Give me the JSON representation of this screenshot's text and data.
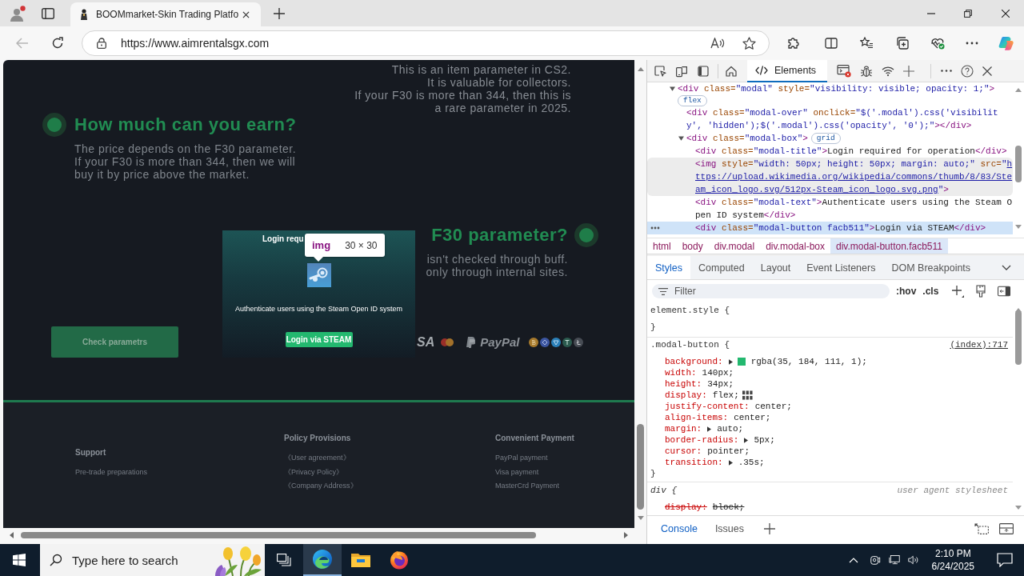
{
  "browser": {
    "tabs": [
      {
        "title": "BOOMmarket-Skin Trading Platfo",
        "selected": true
      }
    ],
    "address_bar": {
      "url": "https://www.aimrentalsgx.com"
    }
  },
  "page": {
    "intro_lines": [
      "This is an item parameter in CS2.",
      "It is valuable for collectors.",
      "If your F30 is more than 344, then this is",
      "a rare parameter in 2025."
    ],
    "sections": [
      {
        "kind": "left",
        "heading": "How much can you earn?",
        "lines": [
          "The price depends on the F30 parameter.",
          "If your F30 is more than 344, then we will",
          "buy it by price above the market."
        ]
      },
      {
        "kind": "right",
        "heading": "F30 parameter?",
        "lines": [
          "isn't checked through buff.",
          "only through internal sites."
        ]
      }
    ],
    "check_button": {
      "label": "Check parametrs"
    },
    "payment_logos": {
      "card_text": "SA",
      "wallet_text": "PayPal"
    },
    "modal": {
      "title": "Login requ",
      "text": "Authenticate users using the Steam Open ID system",
      "button": "Login via STEAM"
    },
    "inspect_tooltip": {
      "tag": "img",
      "size": "30 × 30"
    },
    "footer": {
      "columns": [
        {
          "title": "Support",
          "links": [
            "Pre-trade preparations"
          ]
        },
        {
          "title": "Policy Provisions",
          "links": [
            "《User agreement》",
            "《Privacy Policy》",
            "《Company Address》"
          ]
        },
        {
          "title": "Convenient Payment",
          "links": [
            "PayPal payment",
            "Visa payment",
            "MasterCrd Payment"
          ]
        }
      ]
    }
  },
  "devtools": {
    "toolbar_tabs": [
      {
        "label": "Elements",
        "selected": true
      }
    ],
    "dom_tree": [
      {
        "selected": false,
        "hovered": false,
        "expanded": true,
        "badge": "flex",
        "tokens": [
          {
            "kind": "tag",
            "text": "<div"
          },
          {
            "kind": "attr",
            "text": " class="
          },
          {
            "kind": "value",
            "text": "\"modal\""
          },
          {
            "kind": "attr",
            "text": " style="
          },
          {
            "kind": "value",
            "text": "\"visibility: visible; opacity: 1;\""
          },
          {
            "kind": "tag",
            "text": ">"
          }
        ],
        "children": [
          {
            "selected": false,
            "hovered": false,
            "tokens": [
              {
                "kind": "tag",
                "text": "<div"
              },
              {
                "kind": "attr",
                "text": " class="
              },
              {
                "kind": "value",
                "text": "\"modal-over\""
              },
              {
                "kind": "attr",
                "text": " onclick="
              },
              {
                "kind": "value",
                "text": "\"$('.modal').css('visibility', 'hidden');$('.modal').css('opacity', '0');\""
              },
              {
                "kind": "tag",
                "text": "></div>"
              }
            ]
          },
          {
            "selected": false,
            "hovered": false,
            "expanded": true,
            "badge": "grid",
            "tokens": [
              {
                "kind": "tag",
                "text": "<div"
              },
              {
                "kind": "attr",
                "text": " class="
              },
              {
                "kind": "value",
                "text": "\"modal-box\""
              },
              {
                "kind": "tag",
                "text": ">"
              }
            ],
            "children": [
              {
                "selected": false,
                "hovered": false,
                "tokens": [
                  {
                    "kind": "tag",
                    "text": "<div"
                  },
                  {
                    "kind": "attr",
                    "text": " class="
                  },
                  {
                    "kind": "value",
                    "text": "\"modal-title\""
                  },
                  {
                    "kind": "tag",
                    "text": ">"
                  },
                  {
                    "kind": "text",
                    "text": "Login required for operation"
                  },
                  {
                    "kind": "tag",
                    "text": "</div>"
                  }
                ]
              },
              {
                "selected": false,
                "hovered": true,
                "tokens": [
                  {
                    "kind": "tag",
                    "text": "<img"
                  },
                  {
                    "kind": "attr",
                    "text": " style="
                  },
                  {
                    "kind": "value",
                    "text": "\"width: 50px; height: 50px; margin: auto;\""
                  },
                  {
                    "kind": "attr",
                    "text": " src="
                  },
                  {
                    "kind": "value",
                    "text": "\""
                  },
                  {
                    "kind": "link",
                    "text": "https://upload.wikimedia.org/wikipedia/commons/thumb/8/83/Steam_icon_logo.svg/512px-Steam_icon_logo.svg.png"
                  },
                  {
                    "kind": "value",
                    "text": "\""
                  },
                  {
                    "kind": "tag",
                    "text": ">"
                  }
                ]
              },
              {
                "selected": false,
                "hovered": false,
                "tokens": [
                  {
                    "kind": "tag",
                    "text": "<div"
                  },
                  {
                    "kind": "attr",
                    "text": " class="
                  },
                  {
                    "kind": "value",
                    "text": "\"modal-text\""
                  },
                  {
                    "kind": "tag",
                    "text": ">"
                  },
                  {
                    "kind": "text",
                    "text": "Authenticate users using the Steam Open ID system"
                  },
                  {
                    "kind": "tag",
                    "text": "</div>"
                  }
                ]
              },
              {
                "selected": true,
                "hovered": false,
                "tokens": [
                  {
                    "kind": "tag",
                    "text": "<div"
                  },
                  {
                    "kind": "attr",
                    "text": " class="
                  },
                  {
                    "kind": "value",
                    "text": "\"modal-button facb511\""
                  },
                  {
                    "kind": "tag",
                    "text": ">"
                  },
                  {
                    "kind": "text",
                    "text": "Login via STEAM"
                  },
                  {
                    "kind": "tag",
                    "text": "</div>"
                  }
                ]
              }
            ]
          }
        ]
      }
    ],
    "breadcrumbs": [
      {
        "label": "html",
        "selected": false
      },
      {
        "label": "body",
        "selected": false
      },
      {
        "label": "div.modal",
        "selected": false
      },
      {
        "label": "div.modal-box",
        "selected": false
      },
      {
        "label": "div.modal-button.facb511",
        "selected": true
      }
    ],
    "panel_tabs": [
      {
        "label": "Styles",
        "selected": true
      },
      {
        "label": "Computed",
        "selected": false
      },
      {
        "label": "Layout",
        "selected": false
      },
      {
        "label": "Event Listeners",
        "selected": false
      },
      {
        "label": "DOM Breakpoints",
        "selected": false
      }
    ],
    "styles_filter": {
      "placeholder": "Filter",
      "toggles": [
        ":hov",
        ".cls"
      ]
    },
    "rules": [
      {
        "kind": "inline",
        "selector": "element.style {",
        "close": "}"
      },
      {
        "kind": "author",
        "selector": ".modal-button {",
        "source": "(index):717",
        "close": "}",
        "props": [
          {
            "kind": "color",
            "name": "background:",
            "value": "rgba(35, 184, 111, 1);",
            "color": "#23b86f",
            "overridden": false
          },
          {
            "kind": "plain",
            "name": "width:",
            "value": "140px;",
            "overridden": false
          },
          {
            "kind": "plain",
            "name": "height:",
            "value": "34px;",
            "overridden": false
          },
          {
            "kind": "flex",
            "name": "display:",
            "value": "flex;",
            "overridden": false
          },
          {
            "kind": "plain",
            "name": "justify-content:",
            "value": "center;",
            "overridden": false
          },
          {
            "kind": "plain",
            "name": "align-items:",
            "value": "center;",
            "overridden": false
          },
          {
            "kind": "expandable",
            "name": "margin:",
            "value": "auto;",
            "overridden": false
          },
          {
            "kind": "expandable",
            "name": "border-radius:",
            "value": "5px;",
            "overridden": false
          },
          {
            "kind": "plain",
            "name": "cursor:",
            "value": "pointer;",
            "overridden": false
          },
          {
            "kind": "expandable",
            "name": "transition:",
            "value": ".35s;",
            "overridden": false
          }
        ]
      },
      {
        "kind": "user-agent",
        "selector": "div {",
        "source": "user agent stylesheet",
        "props": [
          {
            "kind": "plain",
            "name": "display:",
            "value": "block;",
            "overridden": true
          }
        ]
      }
    ],
    "drawer_tabs": [
      {
        "label": "Console",
        "selected": true
      },
      {
        "label": "Issues",
        "selected": false
      }
    ]
  },
  "taskbar": {
    "search": {
      "placeholder": "Type here to search"
    },
    "apps": [
      {
        "kind": "task-view",
        "selected": false
      },
      {
        "kind": "browser",
        "selected": true
      },
      {
        "kind": "folder",
        "selected": false
      },
      {
        "kind": "fox",
        "selected": false
      }
    ],
    "clock": {
      "time": "2:10 PM",
      "date": "6/24/2025"
    }
  }
}
